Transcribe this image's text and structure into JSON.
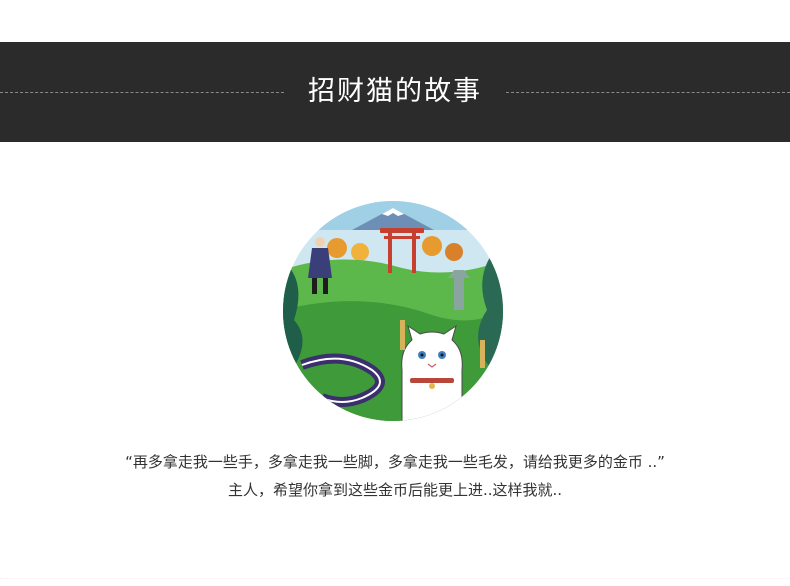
{
  "section": {
    "title": "招财猫的故事"
  },
  "illustration": {
    "subject": "cat-shrine-illustration",
    "colors": {
      "sky": "#9fd0e6",
      "torii": "#c7402f",
      "grass": "#5cb84a",
      "river": "#3b2f6e"
    }
  },
  "story": {
    "line1": "“再多拿走我一些手，多拿走我一些脚，多拿走我一些毛发，请给我更多的金币 ..”",
    "line2": "主人，希望你拿到这些金币后能更上进..这样我就.."
  }
}
